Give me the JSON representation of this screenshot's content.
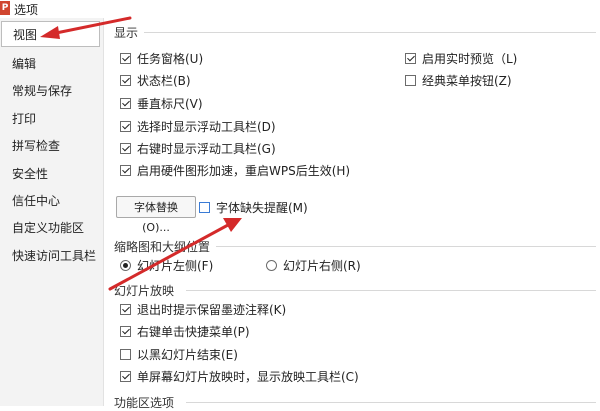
{
  "window": {
    "app_icon_letter": "P",
    "title": "选项"
  },
  "sidebar": {
    "items": [
      {
        "label": "视图",
        "selected": true
      },
      {
        "label": "编辑"
      },
      {
        "label": "常规与保存"
      },
      {
        "label": "打印"
      },
      {
        "label": "拼写检查"
      },
      {
        "label": "安全性"
      },
      {
        "label": "信任中心"
      },
      {
        "label": "自定义功能区"
      },
      {
        "label": "快速访问工具栏"
      }
    ]
  },
  "display": {
    "title": "显示",
    "left_options": [
      {
        "label": "任务窗格(U)",
        "checked": true
      },
      {
        "label": "状态栏(B)",
        "checked": true
      },
      {
        "label": "垂直标尺(V)",
        "checked": true
      },
      {
        "label": "选择时显示浮动工具栏(D)",
        "checked": true
      },
      {
        "label": "右键时显示浮动工具栏(G)",
        "checked": true
      },
      {
        "label": "启用硬件图形加速，重启WPS后生效(H)",
        "checked": true
      }
    ],
    "right_options": [
      {
        "label": "启用实时预览（L)",
        "checked": true
      },
      {
        "label": "经典菜单按钮(Z)",
        "checked": false
      }
    ],
    "font_replace_button": "字体替换(O)...",
    "font_missing_option": {
      "label": "字体缺失提醒(M)",
      "checked": false
    }
  },
  "thumbnail": {
    "title": "缩略图和大纲位置",
    "options": [
      {
        "label": "幻灯片左侧(F)",
        "selected": true
      },
      {
        "label": "幻灯片右侧(R)",
        "selected": false
      }
    ]
  },
  "slideshow": {
    "title": "幻灯片放映",
    "options": [
      {
        "label": "退出时提示保留墨迹注释(K)",
        "checked": true
      },
      {
        "label": "右键单击快捷菜单(P)",
        "checked": true
      },
      {
        "label": "以黑幻灯片结束(E)",
        "checked": false
      },
      {
        "label": "单屏幕幻灯片放映时，显示放映工具栏(C)",
        "checked": true
      }
    ]
  },
  "ribbon": {
    "title": "功能区选项"
  },
  "colors": {
    "arrow": "#d42a2a",
    "sidebar_bg": "#f3f3f3"
  }
}
